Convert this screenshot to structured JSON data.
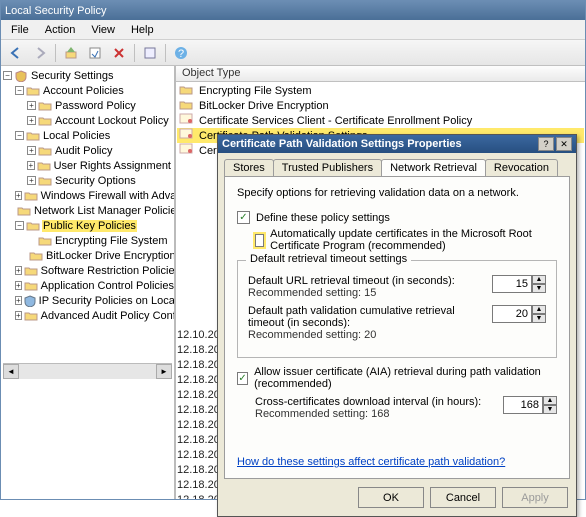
{
  "window": {
    "title": "Local Security Policy"
  },
  "menu": [
    "File",
    "Action",
    "View",
    "Help"
  ],
  "tree": {
    "root": "Security Settings",
    "a": "Account Policies",
    "a1": "Password Policy",
    "a2": "Account Lockout Policy",
    "l": "Local Policies",
    "l1": "Audit Policy",
    "l2": "User Rights Assignment",
    "l3": "Security Options",
    "w": "Windows Firewall with Advanced Security",
    "n": "Network List Manager Policies",
    "p": "Public Key Policies",
    "p1": "Encrypting File System",
    "p2": "BitLocker Drive Encryption",
    "s": "Software Restriction Policies",
    "ac": "Application Control Policies",
    "ip": "IP Security Policies on Local Computer",
    "ad": "Advanced Audit Policy Configuration"
  },
  "right": {
    "header": "Object Type",
    "rows": [
      "Encrypting File System",
      "BitLocker Drive Encryption",
      "Certificate Services Client - Certificate Enrollment Policy",
      "Certificate Path Validation Settings",
      "Certificate Services Client - Auto-Enrollment"
    ]
  },
  "timestamps": [
    "12.10.2012 0:",
    "12.18.2012 0:",
    "12.18.2012 0:",
    "12.18.2012 0:",
    "12.18.2012 0:",
    "12.18.2012 0:",
    "12.18.2012 0:",
    "12.18.2012 0:",
    "12.18.2012 0:",
    "12.18.2012 0:",
    "12.18.2012 0:",
    "12.18.2012 0:",
    "12.18.2012 0:"
  ],
  "dialog": {
    "title": "Certificate Path Validation Settings Properties",
    "tabs": [
      "Stores",
      "Trusted Publishers",
      "Network Retrieval",
      "Revocation"
    ],
    "active_tab": "Network Retrieval",
    "desc": "Specify options for retrieving validation data on a network.",
    "chk_define": "Define these policy settings",
    "chk_auto": "Automatically update certificates in the Microsoft Root Certificate Program (recommended)",
    "grp_legend": "Default retrieval timeout settings",
    "url_label": "Default URL retrieval timeout (in seconds):",
    "url_rec": "Recommended setting: 15",
    "url_val": "15",
    "cum_label": "Default path validation cumulative retrieval timeout (in seconds):",
    "cum_rec": "Recommended setting: 20",
    "cum_val": "20",
    "chk_aia": "Allow issuer certificate (AIA) retrieval during path validation (recommended)",
    "cross_label": "Cross-certificates download interval (in hours):",
    "cross_rec": "Recommended setting: 168",
    "cross_val": "168",
    "link": "How do these settings affect certificate path validation?",
    "ok": "OK",
    "cancel": "Cancel",
    "apply": "Apply"
  }
}
